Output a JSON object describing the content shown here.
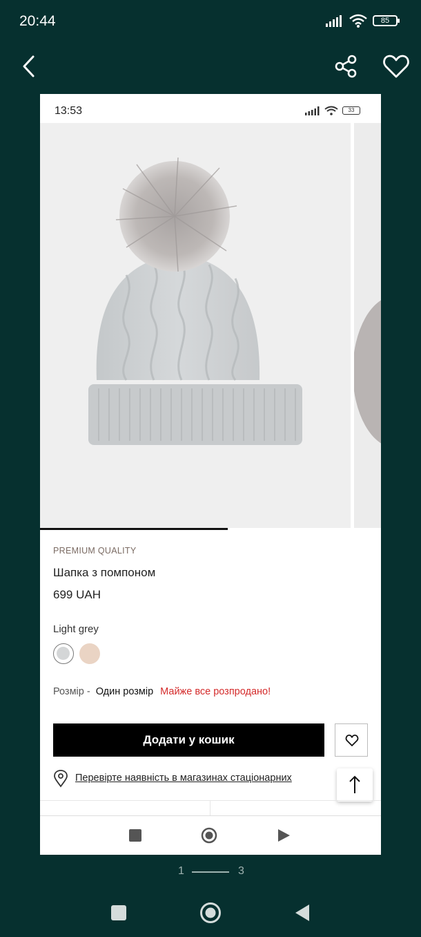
{
  "status_bar": {
    "time": "20:44",
    "battery": "85"
  },
  "viewer": {
    "page_current": "1",
    "page_total": "3"
  },
  "inner_status": {
    "time": "13:53",
    "battery": "33"
  },
  "gallery": {
    "progress_fraction": 0.55
  },
  "product": {
    "brand_tag": "PREMIUM QUALITY",
    "title": "Шапка з помпоном",
    "price": "699 UAH",
    "color_name": "Light grey",
    "swatches": [
      "#d4d6d7",
      "#ead4c4"
    ],
    "size_label": "Розмір -",
    "size_value": "Один розмір",
    "size_warning": "Майже все розпродано!",
    "add_to_cart": "Додати у кошик",
    "store_link": "Перевірте наявність в магазинах стаціонарних"
  },
  "colors": {
    "viewer_bg": "#06302f",
    "warning": "#d42b2b",
    "button": "#000000"
  }
}
